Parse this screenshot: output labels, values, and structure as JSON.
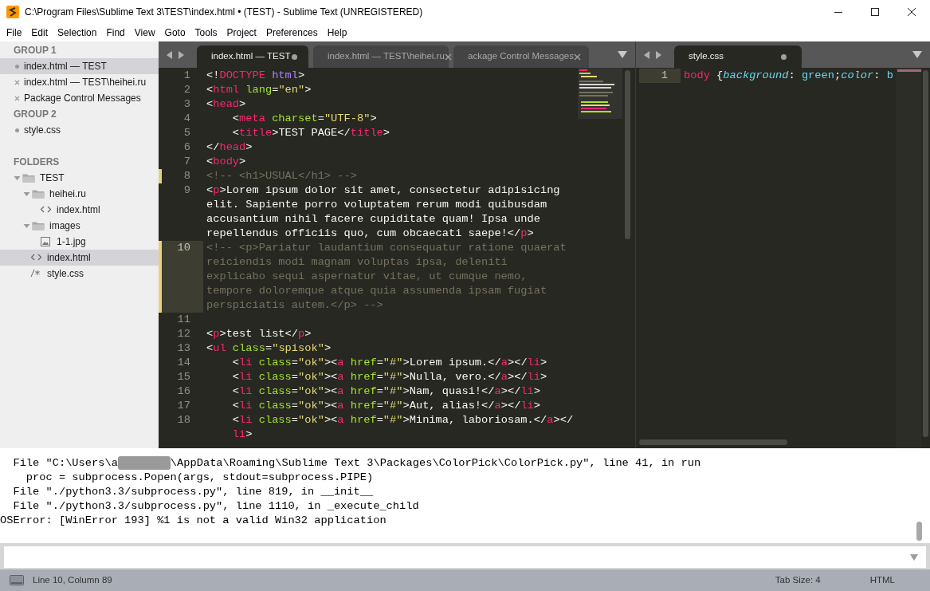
{
  "window": {
    "title": "C:\\Program Files\\Sublime Text 3\\TEST\\index.html • (TEST) - Sublime Text (UNREGISTERED)"
  },
  "menu": [
    "File",
    "Edit",
    "Selection",
    "Find",
    "View",
    "Goto",
    "Tools",
    "Project",
    "Preferences",
    "Help"
  ],
  "sidebar": {
    "groups": [
      {
        "title": "GROUP 1",
        "files": [
          {
            "label": "index.html — TEST",
            "selected": true,
            "dirty": true
          },
          {
            "label": "index.html — TEST\\heihei.ru",
            "selected": false,
            "dirty": false
          },
          {
            "label": "Package Control Messages",
            "selected": false,
            "dirty": false
          }
        ]
      },
      {
        "title": "GROUP 2",
        "files": [
          {
            "label": "style.css",
            "selected": false,
            "dirty": true
          }
        ]
      }
    ],
    "folders_title": "FOLDERS",
    "tree": [
      {
        "label": "TEST",
        "kind": "folder",
        "expanded": true,
        "selected": false,
        "children": [
          {
            "label": "heihei.ru",
            "kind": "folder",
            "expanded": true,
            "selected": false,
            "children": [
              {
                "label": "index.html",
                "kind": "html",
                "selected": false
              }
            ]
          },
          {
            "label": "images",
            "kind": "folder",
            "expanded": true,
            "selected": false,
            "children": [
              {
                "label": "1-1.jpg",
                "kind": "image",
                "selected": false
              }
            ]
          },
          {
            "label": "index.html",
            "kind": "html",
            "selected": true
          },
          {
            "label": "style.css",
            "kind": "css",
            "selected": false
          }
        ]
      }
    ]
  },
  "panes": [
    {
      "tabs": [
        {
          "label": "index.html — TEST",
          "selected": true,
          "dirty": true
        },
        {
          "label": "index.html — TEST\\heihei.ru",
          "selected": false,
          "dirty": false
        },
        {
          "label": "ackage Control Messages",
          "selected": false,
          "dirty": false
        }
      ],
      "lines": [
        {
          "number": "1",
          "current": false,
          "modified": false,
          "rows": [
            {
              "tokens": [
                {
                  "kind": "p",
                  "text": "<!"
                },
                {
                  "kind": "tag",
                  "text": "DOCTYPE"
                },
                {
                  "kind": "kw",
                  "text": " html"
                },
                {
                  "kind": "p",
                  "text": ">"
                }
              ]
            }
          ]
        },
        {
          "number": "2",
          "current": false,
          "modified": false,
          "rows": [
            {
              "tokens": [
                {
                  "kind": "p",
                  "text": "<"
                },
                {
                  "kind": "tag",
                  "text": "html"
                },
                {
                  "kind": "attr",
                  "text": " lang"
                },
                {
                  "kind": "p",
                  "text": "="
                },
                {
                  "kind": "str",
                  "text": "\"en\""
                },
                {
                  "kind": "p",
                  "text": ">"
                }
              ]
            }
          ]
        },
        {
          "number": "3",
          "current": false,
          "modified": false,
          "rows": [
            {
              "tokens": [
                {
                  "kind": "p",
                  "text": "<"
                },
                {
                  "kind": "tag",
                  "text": "head"
                },
                {
                  "kind": "p",
                  "text": ">"
                }
              ]
            }
          ]
        },
        {
          "number": "4",
          "current": false,
          "modified": false,
          "rows": [
            {
              "tokens": [
                {
                  "kind": "p",
                  "text": "    <"
                },
                {
                  "kind": "tag",
                  "text": "meta"
                },
                {
                  "kind": "attr",
                  "text": " charset"
                },
                {
                  "kind": "p",
                  "text": "="
                },
                {
                  "kind": "str",
                  "text": "\"UTF-8\""
                },
                {
                  "kind": "p",
                  "text": ">"
                }
              ]
            }
          ]
        },
        {
          "number": "5",
          "current": false,
          "modified": false,
          "rows": [
            {
              "tokens": [
                {
                  "kind": "p",
                  "text": "    <"
                },
                {
                  "kind": "tag",
                  "text": "title"
                },
                {
                  "kind": "p",
                  "text": ">"
                },
                {
                  "kind": "text",
                  "text": "TEST PAGE"
                },
                {
                  "kind": "p",
                  "text": "</"
                },
                {
                  "kind": "tag",
                  "text": "title"
                },
                {
                  "kind": "p",
                  "text": ">"
                }
              ]
            }
          ]
        },
        {
          "number": "6",
          "current": false,
          "modified": false,
          "rows": [
            {
              "tokens": [
                {
                  "kind": "p",
                  "text": "</"
                },
                {
                  "kind": "tag",
                  "text": "head"
                },
                {
                  "kind": "p",
                  "text": ">"
                }
              ]
            }
          ]
        },
        {
          "number": "7",
          "current": false,
          "modified": false,
          "rows": [
            {
              "tokens": [
                {
                  "kind": "p",
                  "text": "<"
                },
                {
                  "kind": "tag",
                  "text": "body"
                },
                {
                  "kind": "p",
                  "text": ">"
                }
              ]
            }
          ]
        },
        {
          "number": "8",
          "current": false,
          "modified": true,
          "rows": [
            {
              "tokens": [
                {
                  "kind": "cmt",
                  "text": "<!-- <h1>USUAL</h1> -->"
                }
              ]
            }
          ]
        },
        {
          "number": "9",
          "current": false,
          "modified": false,
          "rows": [
            {
              "tokens": [
                {
                  "kind": "p",
                  "text": "<"
                },
                {
                  "kind": "tag",
                  "text": "p"
                },
                {
                  "kind": "p",
                  "text": ">"
                },
                {
                  "kind": "text",
                  "text": "Lorem ipsum dolor sit amet, consectetur adipisicing"
                }
              ]
            },
            {
              "tokens": [
                {
                  "kind": "text",
                  "text": "elit. Sapiente porro voluptatem rerum modi quibusdam"
                }
              ]
            },
            {
              "tokens": [
                {
                  "kind": "text",
                  "text": "accusantium nihil facere cupiditate quam! Ipsa unde"
                }
              ]
            },
            {
              "tokens": [
                {
                  "kind": "text",
                  "text": "repellendus officiis quo, cum obcaecati saepe!"
                },
                {
                  "kind": "p",
                  "text": "</"
                },
                {
                  "kind": "tag",
                  "text": "p"
                },
                {
                  "kind": "p",
                  "text": ">"
                }
              ]
            }
          ]
        },
        {
          "number": "10",
          "current": true,
          "modified": true,
          "rows": [
            {
              "tokens": [
                {
                  "kind": "cmt",
                  "text": "<!-- <p>Pariatur laudantium consequatur ratione quaerat"
                }
              ]
            },
            {
              "tokens": [
                {
                  "kind": "cmt",
                  "text": "reiciendis modi magnam voluptas ipsa, deleniti"
                }
              ]
            },
            {
              "tokens": [
                {
                  "kind": "cmt",
                  "text": "explicabo sequi aspernatur vitae, ut cumque nemo,"
                }
              ]
            },
            {
              "tokens": [
                {
                  "kind": "cmt",
                  "text": "tempore doloremque atque quia assumenda ipsam fugiat"
                }
              ]
            },
            {
              "tokens": [
                {
                  "kind": "cmt",
                  "text": "perspiciatis autem.</p> -->"
                }
              ]
            }
          ]
        },
        {
          "number": "11",
          "current": false,
          "modified": false,
          "rows": [
            {
              "tokens": []
            }
          ]
        },
        {
          "number": "12",
          "current": false,
          "modified": false,
          "rows": [
            {
              "tokens": [
                {
                  "kind": "p",
                  "text": "<"
                },
                {
                  "kind": "tag",
                  "text": "p"
                },
                {
                  "kind": "p",
                  "text": ">"
                },
                {
                  "kind": "text",
                  "text": "test list"
                },
                {
                  "kind": "p",
                  "text": "</"
                },
                {
                  "kind": "tag",
                  "text": "p"
                },
                {
                  "kind": "p",
                  "text": ">"
                }
              ]
            }
          ]
        },
        {
          "number": "13",
          "current": false,
          "modified": false,
          "rows": [
            {
              "tokens": [
                {
                  "kind": "p",
                  "text": "<"
                },
                {
                  "kind": "tag",
                  "text": "ul"
                },
                {
                  "kind": "attr",
                  "text": " class"
                },
                {
                  "kind": "p",
                  "text": "="
                },
                {
                  "kind": "str",
                  "text": "\"spisok\""
                },
                {
                  "kind": "p",
                  "text": ">"
                }
              ]
            }
          ]
        },
        {
          "number": "14",
          "current": false,
          "modified": false,
          "rows": [
            {
              "tokens": [
                {
                  "kind": "p",
                  "text": "    <"
                },
                {
                  "kind": "tag",
                  "text": "li"
                },
                {
                  "kind": "attr",
                  "text": " class"
                },
                {
                  "kind": "p",
                  "text": "="
                },
                {
                  "kind": "str",
                  "text": "\"ok\""
                },
                {
                  "kind": "p",
                  "text": "><"
                },
                {
                  "kind": "tag",
                  "text": "a"
                },
                {
                  "kind": "attr",
                  "text": " href"
                },
                {
                  "kind": "p",
                  "text": "="
                },
                {
                  "kind": "str",
                  "text": "\"#\""
                },
                {
                  "kind": "p",
                  "text": ">"
                },
                {
                  "kind": "text",
                  "text": "Lorem ipsum."
                },
                {
                  "kind": "p",
                  "text": "</"
                },
                {
                  "kind": "tag",
                  "text": "a"
                },
                {
                  "kind": "p",
                  "text": "></"
                },
                {
                  "kind": "tag",
                  "text": "li"
                },
                {
                  "kind": "p",
                  "text": ">"
                }
              ]
            }
          ]
        },
        {
          "number": "15",
          "current": false,
          "modified": false,
          "rows": [
            {
              "tokens": [
                {
                  "kind": "p",
                  "text": "    <"
                },
                {
                  "kind": "tag",
                  "text": "li"
                },
                {
                  "kind": "attr",
                  "text": " class"
                },
                {
                  "kind": "p",
                  "text": "="
                },
                {
                  "kind": "str",
                  "text": "\"ok\""
                },
                {
                  "kind": "p",
                  "text": "><"
                },
                {
                  "kind": "tag",
                  "text": "a"
                },
                {
                  "kind": "attr",
                  "text": " href"
                },
                {
                  "kind": "p",
                  "text": "="
                },
                {
                  "kind": "str",
                  "text": "\"#\""
                },
                {
                  "kind": "p",
                  "text": ">"
                },
                {
                  "kind": "text",
                  "text": "Nulla, vero."
                },
                {
                  "kind": "p",
                  "text": "</"
                },
                {
                  "kind": "tag",
                  "text": "a"
                },
                {
                  "kind": "p",
                  "text": "></"
                },
                {
                  "kind": "tag",
                  "text": "li"
                },
                {
                  "kind": "p",
                  "text": ">"
                }
              ]
            }
          ]
        },
        {
          "number": "16",
          "current": false,
          "modified": false,
          "rows": [
            {
              "tokens": [
                {
                  "kind": "p",
                  "text": "    <"
                },
                {
                  "kind": "tag",
                  "text": "li"
                },
                {
                  "kind": "attr",
                  "text": " class"
                },
                {
                  "kind": "p",
                  "text": "="
                },
                {
                  "kind": "str",
                  "text": "\"ok\""
                },
                {
                  "kind": "p",
                  "text": "><"
                },
                {
                  "kind": "tag",
                  "text": "a"
                },
                {
                  "kind": "attr",
                  "text": " href"
                },
                {
                  "kind": "p",
                  "text": "="
                },
                {
                  "kind": "str",
                  "text": "\"#\""
                },
                {
                  "kind": "p",
                  "text": ">"
                },
                {
                  "kind": "text",
                  "text": "Nam, quasi!"
                },
                {
                  "kind": "p",
                  "text": "</"
                },
                {
                  "kind": "tag",
                  "text": "a"
                },
                {
                  "kind": "p",
                  "text": "></"
                },
                {
                  "kind": "tag",
                  "text": "li"
                },
                {
                  "kind": "p",
                  "text": ">"
                }
              ]
            }
          ]
        },
        {
          "number": "17",
          "current": false,
          "modified": false,
          "rows": [
            {
              "tokens": [
                {
                  "kind": "p",
                  "text": "    <"
                },
                {
                  "kind": "tag",
                  "text": "li"
                },
                {
                  "kind": "attr",
                  "text": " class"
                },
                {
                  "kind": "p",
                  "text": "="
                },
                {
                  "kind": "str",
                  "text": "\"ok\""
                },
                {
                  "kind": "p",
                  "text": "><"
                },
                {
                  "kind": "tag",
                  "text": "a"
                },
                {
                  "kind": "attr",
                  "text": " href"
                },
                {
                  "kind": "p",
                  "text": "="
                },
                {
                  "kind": "str",
                  "text": "\"#\""
                },
                {
                  "kind": "p",
                  "text": ">"
                },
                {
                  "kind": "text",
                  "text": "Aut, alias!"
                },
                {
                  "kind": "p",
                  "text": "</"
                },
                {
                  "kind": "tag",
                  "text": "a"
                },
                {
                  "kind": "p",
                  "text": "></"
                },
                {
                  "kind": "tag",
                  "text": "li"
                },
                {
                  "kind": "p",
                  "text": ">"
                }
              ]
            }
          ]
        },
        {
          "number": "18",
          "current": false,
          "modified": false,
          "rows": [
            {
              "tokens": [
                {
                  "kind": "p",
                  "text": "    <"
                },
                {
                  "kind": "tag",
                  "text": "li"
                },
                {
                  "kind": "attr",
                  "text": " class"
                },
                {
                  "kind": "p",
                  "text": "="
                },
                {
                  "kind": "str",
                  "text": "\"ok\""
                },
                {
                  "kind": "p",
                  "text": "><"
                },
                {
                  "kind": "tag",
                  "text": "a"
                },
                {
                  "kind": "attr",
                  "text": " href"
                },
                {
                  "kind": "p",
                  "text": "="
                },
                {
                  "kind": "str",
                  "text": "\"#\""
                },
                {
                  "kind": "p",
                  "text": ">"
                },
                {
                  "kind": "text",
                  "text": "Minima, laboriosam."
                },
                {
                  "kind": "p",
                  "text": "</"
                },
                {
                  "kind": "tag",
                  "text": "a"
                },
                {
                  "kind": "p",
                  "text": "></"
                }
              ]
            },
            {
              "tokens": [
                {
                  "kind": "tag",
                  "text": "    li"
                },
                {
                  "kind": "p",
                  "text": ">"
                }
              ]
            }
          ]
        }
      ]
    },
    {
      "tabs": [
        {
          "label": "style.css",
          "selected": true,
          "dirty": true
        }
      ],
      "lines": [
        {
          "number": "1",
          "current": true,
          "modified": false,
          "rows": [
            {
              "tokens": [
                {
                  "kind": "tag",
                  "text": "body"
                },
                {
                  "kind": "p",
                  "text": " {"
                },
                {
                  "kind": "prop",
                  "text": "background"
                },
                {
                  "kind": "p",
                  "text": ": "
                },
                {
                  "kind": "val",
                  "text": "green"
                },
                {
                  "kind": "p",
                  "text": ";"
                },
                {
                  "kind": "prop",
                  "text": "color"
                },
                {
                  "kind": "p",
                  "text": ": "
                },
                {
                  "kind": "val",
                  "text": "b"
                }
              ]
            }
          ]
        }
      ]
    }
  ],
  "console": [
    {
      "kind": "redacted",
      "before": "  File \"C:\\Users\\a",
      "after": "\\AppData\\Roaming\\Sublime Text 3\\Packages\\ColorPick\\ColorPick.py\", line 41, in run"
    },
    {
      "kind": "plain",
      "text": "    proc = subprocess.Popen(args, stdout=subprocess.PIPE)"
    },
    {
      "kind": "plain",
      "text": "  File \"./python3.3/subprocess.py\", line 819, in __init__"
    },
    {
      "kind": "plain",
      "text": "  File \"./python3.3/subprocess.py\", line 1110, in _execute_child"
    },
    {
      "kind": "plain",
      "text": "OSError: [WinError 193] %1 is not a valid Win32 application"
    }
  ],
  "status_bar": {
    "position": "Line 10, Column 89",
    "tab_size": "Tab Size: 4",
    "syntax": "HTML"
  }
}
